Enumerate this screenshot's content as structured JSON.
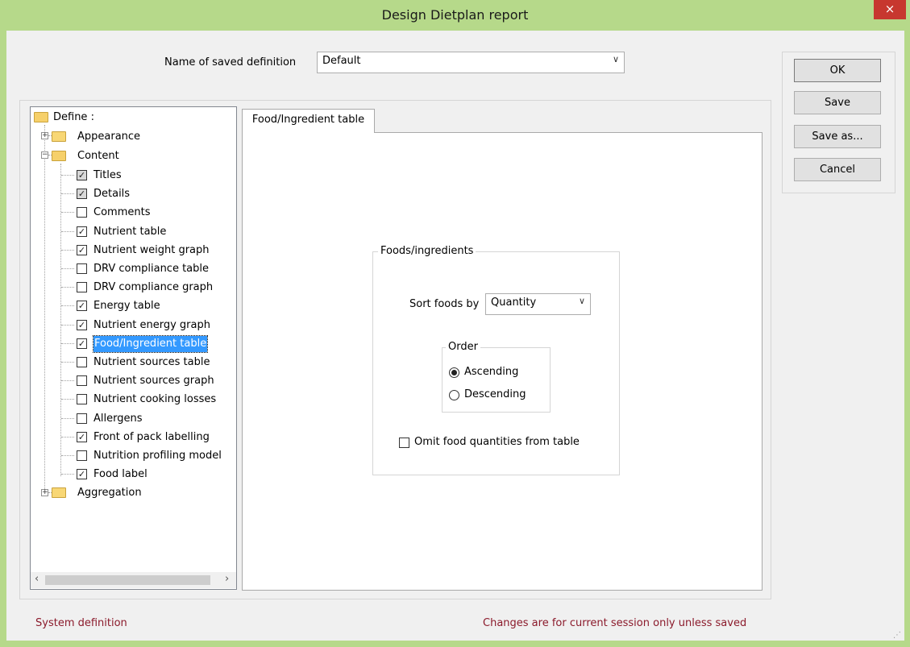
{
  "window": {
    "title": "Design Dietplan report",
    "close_icon": "×"
  },
  "definition": {
    "label": "Name of saved definition",
    "value": "Default"
  },
  "buttons": {
    "ok": "OK",
    "save": "Save",
    "save_as": "Save as...",
    "cancel": "Cancel"
  },
  "tree": {
    "root": "Define :",
    "appearance": "Appearance",
    "content": "Content",
    "aggregation": "Aggregation",
    "items": [
      {
        "label": "Titles",
        "state": "checked-grey"
      },
      {
        "label": "Details",
        "state": "checked-grey"
      },
      {
        "label": "Comments",
        "state": "unchecked"
      },
      {
        "label": "Nutrient table",
        "state": "checked"
      },
      {
        "label": "Nutrient weight graph",
        "state": "checked"
      },
      {
        "label": "DRV compliance table",
        "state": "unchecked"
      },
      {
        "label": "DRV compliance graph",
        "state": "unchecked"
      },
      {
        "label": "Energy table",
        "state": "checked"
      },
      {
        "label": "Nutrient energy graph",
        "state": "checked"
      },
      {
        "label": "Food/Ingredient table",
        "state": "checked",
        "selected": true
      },
      {
        "label": "Nutrient sources table",
        "state": "unchecked"
      },
      {
        "label": "Nutrient sources graph",
        "state": "unchecked"
      },
      {
        "label": "Nutrient cooking losses",
        "state": "unchecked"
      },
      {
        "label": "Allergens",
        "state": "unchecked"
      },
      {
        "label": "Front of pack labelling",
        "state": "checked"
      },
      {
        "label": "Nutrition profiling model",
        "state": "unchecked"
      },
      {
        "label": "Food label",
        "state": "checked"
      }
    ]
  },
  "tab": {
    "label": "Food/Ingredient table",
    "group_label": "Foods/ingredients",
    "sort_label": "Sort foods by",
    "sort_value": "Quantity",
    "order_label": "Order",
    "ascending": "Ascending",
    "descending": "Descending",
    "order_selected": "Ascending",
    "omit_label": "Omit food quantities from table",
    "omit_checked": false
  },
  "status": {
    "left": "System definition",
    "right": "Changes are for current session only unless saved"
  },
  "colors": {
    "titlebar": "#b6d98a",
    "close": "#c7372f",
    "status_text": "#8b1a2b",
    "selection": "#3399ff"
  }
}
